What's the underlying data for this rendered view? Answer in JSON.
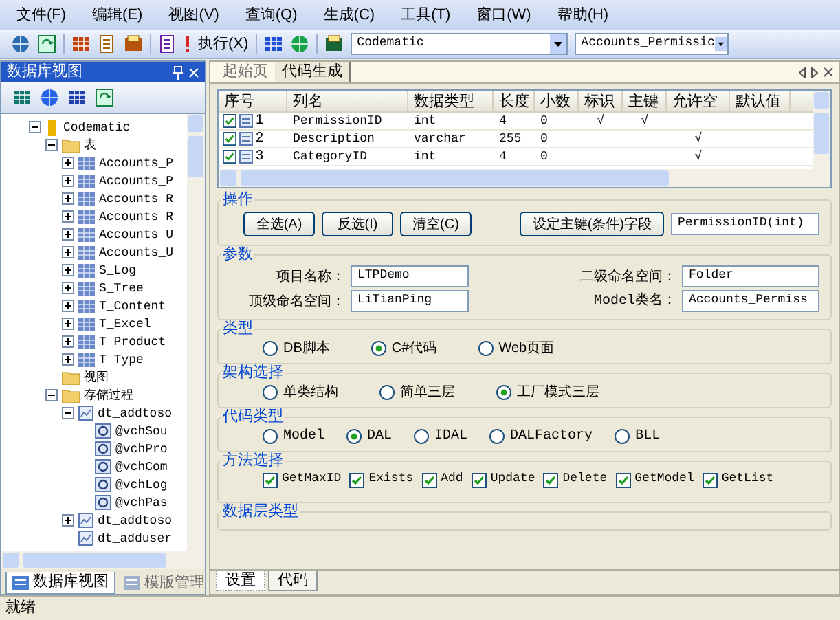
{
  "menu": [
    "文件(F)",
    "编辑(E)",
    "视图(V)",
    "查询(Q)",
    "生成(C)",
    "工具(T)",
    "窗口(W)",
    "帮助(H)"
  ],
  "toolbar": {
    "run_label": "执行(X)",
    "server_combo": "Codematic",
    "table_combo": "Accounts_Permissic"
  },
  "left_panel": {
    "title": "数据库视图",
    "tree": [
      {
        "label": "Codematic",
        "kind": "database",
        "expanded": true,
        "children": [
          {
            "label": "表",
            "kind": "folder",
            "expanded": true,
            "children": [
              {
                "label": "Accounts_P",
                "kind": "table",
                "expanded": false
              },
              {
                "label": "Accounts_P",
                "kind": "table",
                "expanded": false
              },
              {
                "label": "Accounts_R",
                "kind": "table",
                "expanded": false
              },
              {
                "label": "Accounts_R",
                "kind": "table",
                "expanded": false
              },
              {
                "label": "Accounts_U",
                "kind": "table",
                "expanded": false
              },
              {
                "label": "Accounts_U",
                "kind": "table",
                "expanded": false
              },
              {
                "label": "S_Log",
                "kind": "table",
                "expanded": false
              },
              {
                "label": "S_Tree",
                "kind": "table",
                "expanded": false
              },
              {
                "label": "T_Content",
                "kind": "table",
                "expanded": false
              },
              {
                "label": "T_Excel",
                "kind": "table",
                "expanded": false
              },
              {
                "label": "T_Product",
                "kind": "table",
                "expanded": false
              },
              {
                "label": "T_Type",
                "kind": "table",
                "expanded": false
              }
            ]
          },
          {
            "label": "视图",
            "kind": "folder"
          },
          {
            "label": "存储过程",
            "kind": "folder",
            "expanded": true,
            "children": [
              {
                "label": "dt_addtoso",
                "kind": "procedure",
                "expanded": true,
                "children": [
                  {
                    "label": "@vchSou",
                    "kind": "param"
                  },
                  {
                    "label": "@vchPro",
                    "kind": "param"
                  },
                  {
                    "label": "@vchCom",
                    "kind": "param"
                  },
                  {
                    "label": "@vchLog",
                    "kind": "param"
                  },
                  {
                    "label": "@vchPas",
                    "kind": "param"
                  }
                ]
              },
              {
                "label": "dt_addtoso",
                "kind": "procedure",
                "expanded": false
              },
              {
                "label": "dt_adduser",
                "kind": "procedure"
              }
            ]
          }
        ]
      }
    ],
    "tabs": [
      {
        "label": "数据库视图",
        "selected": true
      },
      {
        "label": "模版管理",
        "selected": false
      }
    ]
  },
  "doc_tabs": [
    {
      "label": "起始页",
      "selected": false
    },
    {
      "label": "代码生成",
      "selected": true
    }
  ],
  "columns_table": {
    "columns": [
      "序号",
      "列名",
      "数据类型",
      "长度",
      "小数",
      "标识",
      "主键",
      "允许空",
      "默认值"
    ],
    "rows": [
      {
        "checked": true,
        "index": "1",
        "name": "PermissionID",
        "type": "int",
        "length": "4",
        "scale": "0",
        "identity": "√",
        "primary_key": "√"
      },
      {
        "checked": true,
        "index": "2",
        "name": "Description",
        "type": "varchar",
        "length": "255",
        "scale": "0",
        "nullable": "√"
      },
      {
        "checked": true,
        "index": "3",
        "name": "CategoryID",
        "type": "int",
        "length": "4",
        "scale": "0",
        "nullable": "√"
      }
    ]
  },
  "operations": {
    "title": "操作",
    "buttons": [
      "全选(A)",
      "反选(I)",
      "清空(C)"
    ],
    "key_button": "设定主键(条件)字段",
    "key_value": "PermissionID(int)"
  },
  "params": {
    "title": "参数",
    "fields": [
      {
        "label": "项目名称：",
        "value": "LTPDemo"
      },
      {
        "label": "二级命名空间：",
        "value": "Folder"
      },
      {
        "label": "顶级命名空间：",
        "value": "LiTianPing"
      },
      {
        "label": "Model类名：",
        "value": "Accounts_Permiss"
      }
    ]
  },
  "type_group": {
    "title": "类型",
    "options": [
      {
        "label": "DB脚本",
        "selected": false
      },
      {
        "label": "C#代码",
        "selected": true
      },
      {
        "label": "Web页面",
        "selected": false
      }
    ]
  },
  "architecture": {
    "title": "架构选择",
    "options": [
      {
        "label": "单类结构",
        "selected": false
      },
      {
        "label": "简单三层",
        "selected": false
      },
      {
        "label": "工厂模式三层",
        "selected": true
      }
    ]
  },
  "code_type": {
    "title": "代码类型",
    "options": [
      {
        "label": "Model",
        "selected": false
      },
      {
        "label": "DAL",
        "selected": true
      },
      {
        "label": "IDAL",
        "selected": false
      },
      {
        "label": "DALFactory",
        "selected": false
      },
      {
        "label": "BLL",
        "selected": false
      }
    ]
  },
  "methods": {
    "title": "方法选择",
    "options": [
      {
        "label": "GetMaxID",
        "checked": true
      },
      {
        "label": "Exists",
        "checked": true
      },
      {
        "label": "Add",
        "checked": true
      },
      {
        "label": "Update",
        "checked": true
      },
      {
        "label": "Delete",
        "checked": true
      },
      {
        "label": "GetModel",
        "checked": true
      },
      {
        "label": "GetList",
        "checked": true
      }
    ]
  },
  "data_layer": {
    "title": "数据层类型"
  },
  "bottom_tabs": [
    {
      "label": "设置",
      "selected": true
    },
    {
      "label": "代码",
      "selected": false
    }
  ],
  "status_bar": {
    "text": "就绪"
  }
}
